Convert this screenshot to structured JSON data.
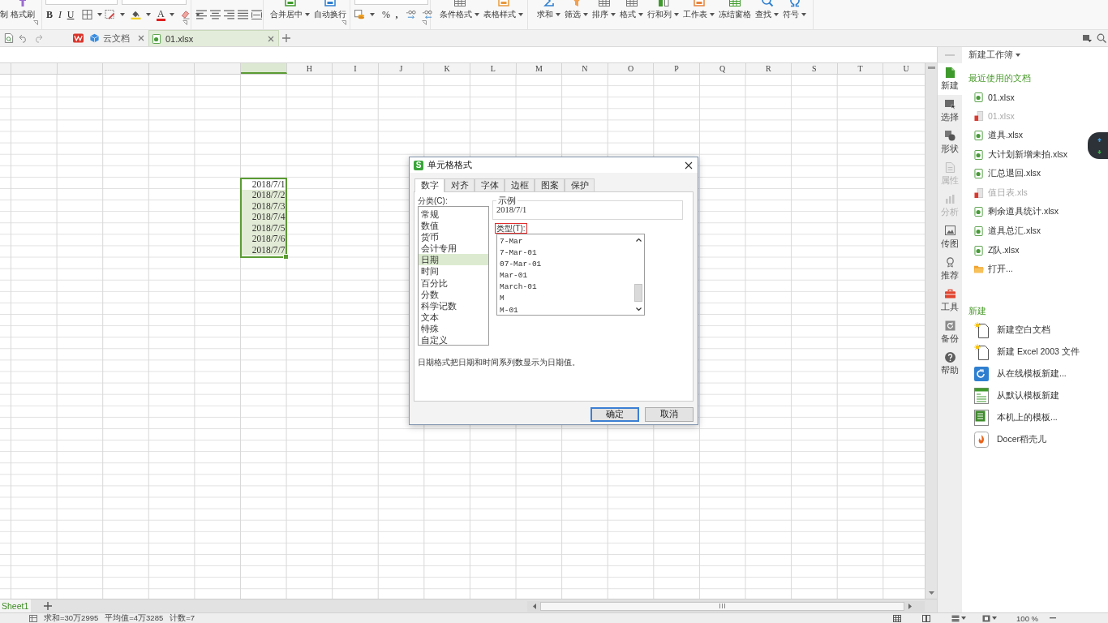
{
  "ribbon": {
    "clipboard": [
      {
        "label": "制",
        "dropdown": false
      },
      {
        "label": "格式刷",
        "dropdown": false
      }
    ],
    "font": {
      "bold": "B",
      "italic": "I",
      "underline": "U",
      "font_color": "A"
    },
    "merge": [
      {
        "label": "合并居中",
        "dropdown": true
      },
      {
        "label": "自动换行",
        "dropdown": false
      }
    ],
    "number": {
      "percent": "%",
      "thousands": ","
    },
    "styles": [
      {
        "label": "条件格式",
        "dropdown": true
      },
      {
        "label": "表格样式",
        "dropdown": true
      }
    ],
    "editing": [
      {
        "label": "求和",
        "dropdown": true
      },
      {
        "label": "筛选",
        "dropdown": true
      },
      {
        "label": "排序",
        "dropdown": true
      },
      {
        "label": "格式",
        "dropdown": true
      },
      {
        "label": "行和列",
        "dropdown": true
      },
      {
        "label": "工作表",
        "dropdown": true
      },
      {
        "label": "冻结窗格",
        "dropdown": false
      },
      {
        "label": "查找",
        "dropdown": true
      },
      {
        "label": "符号",
        "dropdown": true
      }
    ]
  },
  "doc_tabs": [
    {
      "kind": "home",
      "selected": false,
      "closable": false
    },
    {
      "kind": "cloud",
      "label": "云文档",
      "selected": false,
      "closable": true
    },
    {
      "kind": "file",
      "label": "01.xlsx",
      "selected": true,
      "closable": true
    }
  ],
  "sheet": {
    "columns": [
      {
        "selected": false
      },
      {
        "selected": false
      },
      {
        "selected": false
      },
      {
        "selected": false
      },
      {
        "selected": false
      },
      {
        "selected": false
      },
      {
        "selected": true
      },
      {
        "label": "H",
        "selected": false
      },
      {
        "label": "I",
        "selected": false
      },
      {
        "label": "J",
        "selected": false
      },
      {
        "label": "K",
        "selected": false
      },
      {
        "label": "L",
        "selected": false
      },
      {
        "label": "M",
        "selected": false
      },
      {
        "label": "N",
        "selected": false
      },
      {
        "label": "O",
        "selected": false
      },
      {
        "label": "P",
        "selected": false
      },
      {
        "label": "Q",
        "selected": false
      },
      {
        "label": "R",
        "selected": false
      },
      {
        "label": "S",
        "selected": false
      },
      {
        "label": "T",
        "selected": false
      },
      {
        "label": "U",
        "selected": false
      }
    ],
    "cells": [
      {
        "text": "2018/7/1",
        "active": true
      },
      {
        "text": "2018/7/2",
        "active": false
      },
      {
        "text": "2018/7/3",
        "active": false
      },
      {
        "text": "2018/7/4",
        "active": false
      },
      {
        "text": "2018/7/5",
        "active": false
      },
      {
        "text": "2018/7/6",
        "active": false
      },
      {
        "text": "2018/7/7",
        "active": false
      }
    ]
  },
  "sheet_tabs": [
    {
      "label": "Sheet1",
      "selected": true
    }
  ],
  "dialog": {
    "badge": "S",
    "title": "单元格格式",
    "tabs": [
      {
        "label": "数字",
        "selected": true
      },
      {
        "label": "对齐",
        "selected": false
      },
      {
        "label": "字体",
        "selected": false
      },
      {
        "label": "边框",
        "selected": false
      },
      {
        "label": "图案",
        "selected": false
      },
      {
        "label": "保护",
        "selected": false
      }
    ],
    "category_label": "分类(C):",
    "categories": [
      {
        "label": "常规",
        "selected": false
      },
      {
        "label": "数值",
        "selected": false
      },
      {
        "label": "货币",
        "selected": false
      },
      {
        "label": "会计专用",
        "selected": false
      },
      {
        "label": "日期",
        "selected": true
      },
      {
        "label": "时间",
        "selected": false
      },
      {
        "label": "百分比",
        "selected": false
      },
      {
        "label": "分数",
        "selected": false
      },
      {
        "label": "科学记数",
        "selected": false
      },
      {
        "label": "文本",
        "selected": false
      },
      {
        "label": "特殊",
        "selected": false
      },
      {
        "label": "自定义",
        "selected": false
      }
    ],
    "sample_label": "示例",
    "sample": "2018/7/1",
    "type_label": "类型(T):",
    "type_label_highlighted": true,
    "types": [
      {
        "label": "7-Mar",
        "selected": false
      },
      {
        "label": "7-Mar-01",
        "selected": false
      },
      {
        "label": "07-Mar-01",
        "selected": false
      },
      {
        "label": "Mar-01",
        "selected": false
      },
      {
        "label": "March-01",
        "selected": false
      },
      {
        "label": "M",
        "selected": false
      },
      {
        "label": "M-01",
        "selected": false
      }
    ],
    "description": "日期格式把日期和时间系列数显示为日期值。",
    "buttons": [
      {
        "label": "确定",
        "kind": "default"
      },
      {
        "label": "取消",
        "kind": "normal"
      }
    ]
  },
  "task_pane": {
    "side_tabs": [
      {
        "label": "新建",
        "selected": true,
        "disabled": false
      },
      {
        "label": "选择",
        "selected": false,
        "disabled": false
      },
      {
        "label": "形状",
        "selected": false,
        "disabled": false
      },
      {
        "label": "属性",
        "selected": false,
        "disabled": true
      },
      {
        "label": "分析",
        "selected": false,
        "disabled": true
      },
      {
        "label": "传图",
        "selected": false,
        "disabled": false
      },
      {
        "label": "推荐",
        "selected": false,
        "disabled": false
      },
      {
        "label": "工具",
        "selected": false,
        "disabled": false
      },
      {
        "label": "备份",
        "selected": false,
        "disabled": false
      },
      {
        "label": "帮助",
        "selected": false,
        "disabled": false
      }
    ],
    "title": "新建工作簿",
    "recent_heading": "最近使用的文档",
    "recent": [
      {
        "name": "01.xlsx",
        "missing": false
      },
      {
        "name": "01.xlsx",
        "missing": true
      },
      {
        "name": "道具.xlsx",
        "missing": false
      },
      {
        "name": "大计划新增未拍.xlsx",
        "missing": false
      },
      {
        "name": "汇总退回.xlsx",
        "missing": false
      },
      {
        "name": "值日表.xls",
        "missing": true
      },
      {
        "name": "剩余道具统计.xlsx",
        "missing": false
      },
      {
        "name": "道具总汇.xlsx",
        "missing": false
      },
      {
        "name": "Z队.xlsx",
        "missing": false
      }
    ],
    "open": "打开...",
    "new_heading": "新建",
    "new_items": [
      {
        "kind": "blank",
        "label": "新建空白文档"
      },
      {
        "kind": "blank",
        "label": "新建 Excel 2003 文件"
      },
      {
        "kind": "online",
        "label": "从在线模板新建..."
      },
      {
        "kind": "default",
        "label": "从默认模板新建"
      },
      {
        "kind": "local",
        "label": "本机上的模板..."
      },
      {
        "kind": "docer",
        "label": "Docer稻壳儿"
      }
    ]
  },
  "status_bar": {
    "summary": [
      "求和=30万2995",
      "平均值=4万3285",
      "计数=7"
    ],
    "zoom": "100 %"
  }
}
